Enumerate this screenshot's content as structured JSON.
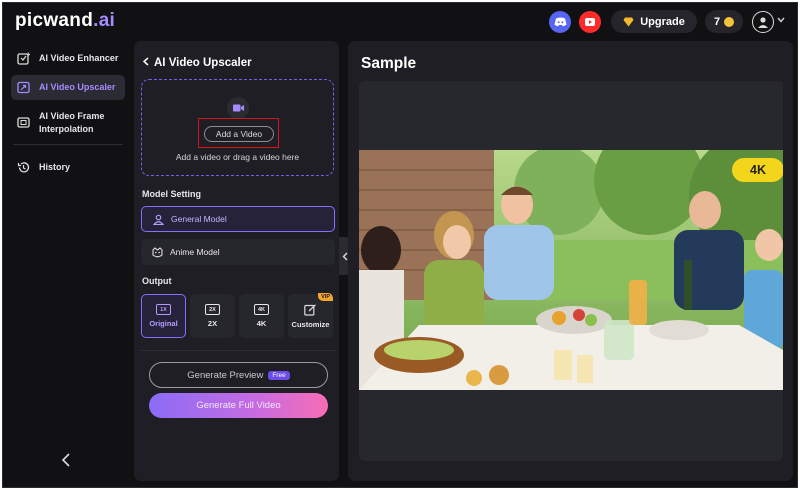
{
  "brand": {
    "logo_main": "picwand",
    "logo_ai": ".ai"
  },
  "topbar": {
    "discord_icon": "discord-icon",
    "youtube_icon": "youtube-icon",
    "upgrade_label": "Upgrade",
    "credits_count": "7",
    "avatar_icon": "user-avatar-icon"
  },
  "sidebar": {
    "items": [
      {
        "label": "AI Video Enhancer",
        "icon": "video-enhance-icon",
        "active": false
      },
      {
        "label": "AI Video Upscaler",
        "icon": "video-upscale-icon",
        "active": true
      },
      {
        "label": "AI Video Frame Interpolation",
        "icon": "frame-interpolation-icon",
        "active": false
      },
      {
        "label": "History",
        "icon": "history-icon",
        "active": false
      }
    ],
    "collapse_glyph": "<"
  },
  "panel": {
    "title": "AI Video Upscaler",
    "upload": {
      "button_label": "Add a Video",
      "hint": "Add a video or drag a video here"
    },
    "model_setting_label": "Model Setting",
    "models": [
      {
        "label": "General Model",
        "selected": true
      },
      {
        "label": "Anime Model",
        "selected": false
      }
    ],
    "output_label": "Output",
    "outputs": [
      {
        "badge": "1X",
        "label": "Original",
        "selected": true
      },
      {
        "badge": "2X",
        "label": "2X",
        "selected": false
      },
      {
        "badge": "4K",
        "label": "4K",
        "selected": false
      },
      {
        "badge": "",
        "label": "Customize",
        "selected": false,
        "tag": "VIP"
      }
    ],
    "preview_button": "Generate Preview",
    "preview_badge": "Free",
    "full_button": "Generate Full Video"
  },
  "sample": {
    "title": "Sample",
    "resolution_badge": "4K"
  },
  "colors": {
    "background": "#111114",
    "panel": "#1e1e24",
    "accent": "#8c6cff",
    "badge_yellow": "#f3d61c",
    "highlight_red": "#d01818"
  }
}
